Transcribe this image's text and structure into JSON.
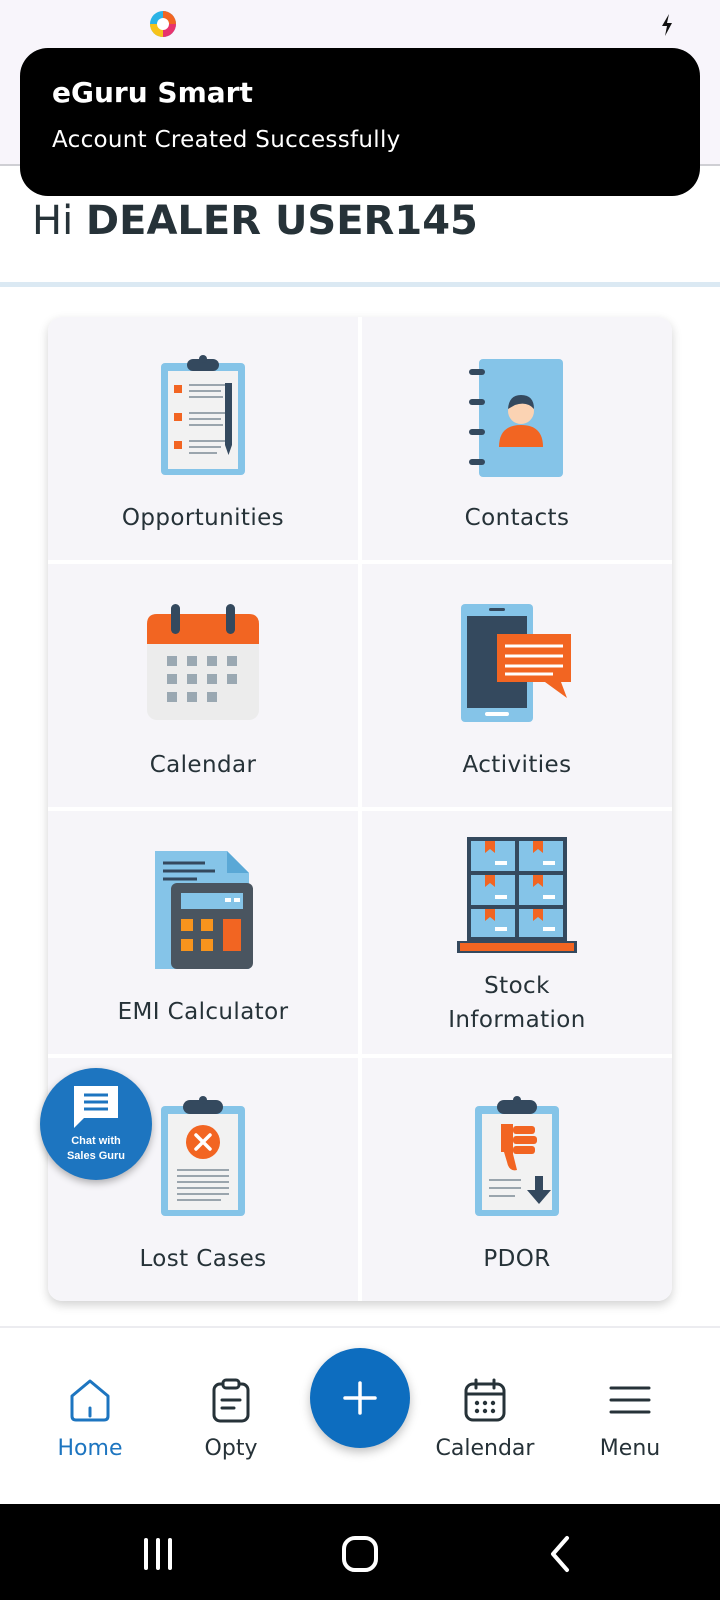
{
  "toast": {
    "title": "eGuru Smart",
    "message": "Account Created Successfully"
  },
  "greeting": {
    "prefix": "Hi",
    "user_name": "DEALER USER145"
  },
  "tiles": [
    {
      "label": "Opportunities",
      "icon": "clipboard-checklist-icon"
    },
    {
      "label": "Contacts",
      "icon": "contact-book-icon"
    },
    {
      "label": "Calendar",
      "icon": "calendar-icon"
    },
    {
      "label": "Activities",
      "icon": "phone-message-icon"
    },
    {
      "label": "EMI Calculator",
      "icon": "calculator-icon"
    },
    {
      "label": "Stock Information",
      "icon": "warehouse-shelves-icon"
    },
    {
      "label": "Lost Cases",
      "icon": "clipboard-cancel-icon"
    },
    {
      "label": "PDOR",
      "icon": "clipboard-thumbs-down-icon"
    }
  ],
  "chat_fab": {
    "line1": "Chat with",
    "line2": "Sales Guru"
  },
  "bottom_nav": {
    "items": [
      {
        "label": "Home",
        "active": true
      },
      {
        "label": "Opty",
        "active": false
      },
      {
        "label": "Calendar",
        "active": false
      },
      {
        "label": "Menu",
        "active": false
      }
    ]
  },
  "colors": {
    "primary": "#1d75c0",
    "accent_orange": "#f26522",
    "text_dark": "#263238",
    "tile_bg": "#f6f5f9",
    "light_blue": "#85c4e8"
  }
}
